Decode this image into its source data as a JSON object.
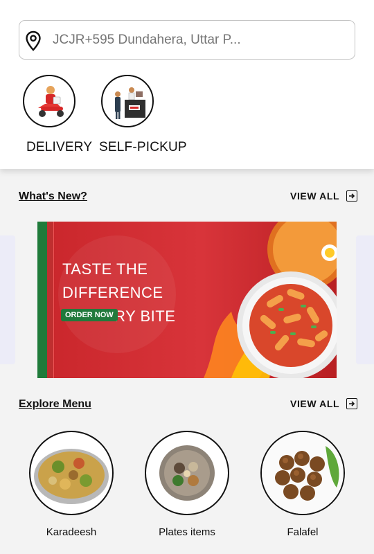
{
  "location": {
    "value": "",
    "placeholder": "JCJR+595 Dundahera, Uttar P...",
    "icon": "location-pin-icon"
  },
  "order_modes": [
    {
      "label": "DELIVERY",
      "image": "delivery-scooter-image"
    },
    {
      "label": "SELF-PICKUP",
      "image": "self-pickup-counter-image"
    }
  ],
  "whats_new": {
    "title": "What's New?",
    "view_all": "VIEW ALL",
    "banner": {
      "headline_line1": "TASTE THE DIFFERENCE",
      "headline_line2": "IN EVERY BITE",
      "cta": "ORDER NOW"
    }
  },
  "explore_menu": {
    "title": "Explore Menu",
    "view_all": "VIEW ALL",
    "items": [
      {
        "label": "Karadeesh"
      },
      {
        "label": "Plates items"
      },
      {
        "label": "Falafel"
      }
    ]
  },
  "colors": {
    "banner_red": "#d32f2f",
    "banner_green": "#217a3c",
    "page_bg": "#f3f3f3"
  }
}
